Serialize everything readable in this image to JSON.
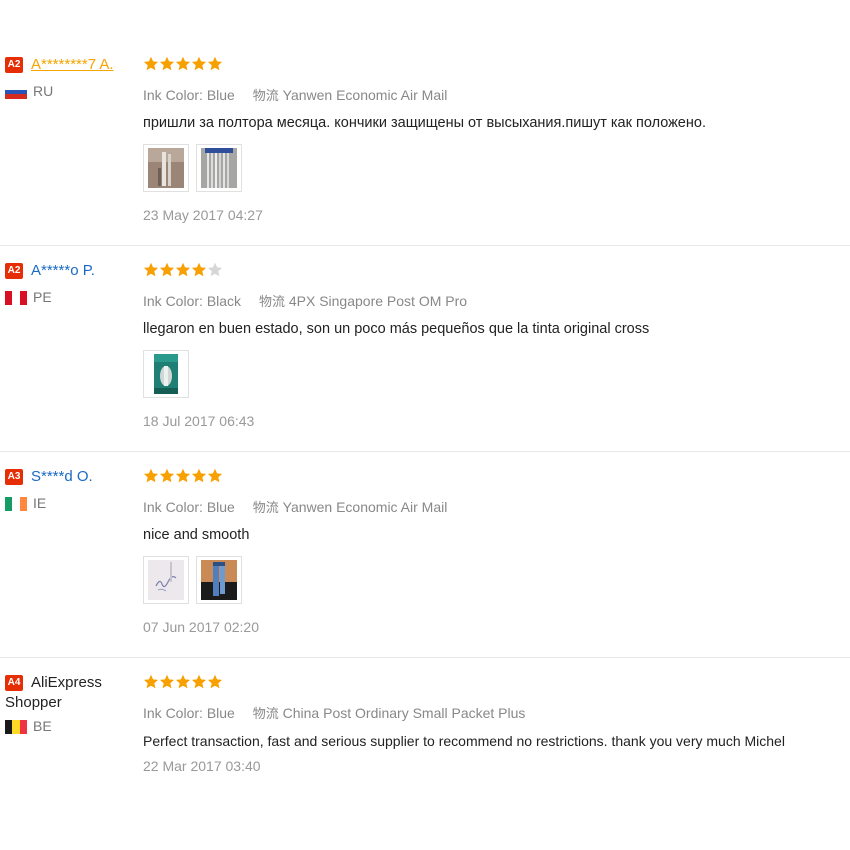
{
  "labels": {
    "ink_color": "Ink Color:",
    "logistics": "物流"
  },
  "colors": {
    "star_filled": "#f7a000",
    "star_empty": "#d6d6d6",
    "level_badge": "#e62e04",
    "user_link": "#1a6ac4",
    "highlight_user": "#f5a400"
  },
  "reviews": [
    {
      "level": "A2",
      "user": "A********7 A.",
      "user_cont": "",
      "country_code": "RU",
      "flag": "russia-flag",
      "rating": 5,
      "ink_color": "Blue",
      "shipping": "Yanwen Economic Air Mail",
      "text": "пришли за полтора месяца. кончики защищены от высыхания.пишут как положено.",
      "photos": [
        "photo-pen-tips",
        "photo-pen-refills"
      ],
      "date": "23 May 2017 04:27"
    },
    {
      "level": "A2",
      "user": "A*****o P.",
      "user_cont": "",
      "country_code": "PE",
      "flag": "peru-flag",
      "rating": 4,
      "ink_color": "Black",
      "shipping": "4PX Singapore Post OM Pro",
      "text": "llegaron en buen estado, son un poco más pequeños que la tinta original cross",
      "photos": [
        "photo-package"
      ],
      "date": "18 Jul 2017 06:43"
    },
    {
      "level": "A3",
      "user": "S****d O.",
      "user_cont": "",
      "country_code": "IE",
      "flag": "ireland-flag",
      "rating": 5,
      "ink_color": "Blue",
      "shipping": "Yanwen Economic Air Mail",
      "text": "nice and smooth",
      "photos": [
        "photo-writing-sample",
        "photo-refills-in-hand"
      ],
      "date": "07 Jun 2017 02:20"
    },
    {
      "level": "A4",
      "user": "AliExpress",
      "user_cont": "Shopper",
      "country_code": "BE",
      "flag": "belgium-flag",
      "rating": 5,
      "ink_color": "Blue",
      "shipping": "China Post Ordinary Small Packet Plus",
      "text": "Perfect transaction, fast and serious supplier to recommend no restrictions. thank you very much Michel",
      "photos": [],
      "date": "22 Mar 2017 03:40"
    }
  ]
}
